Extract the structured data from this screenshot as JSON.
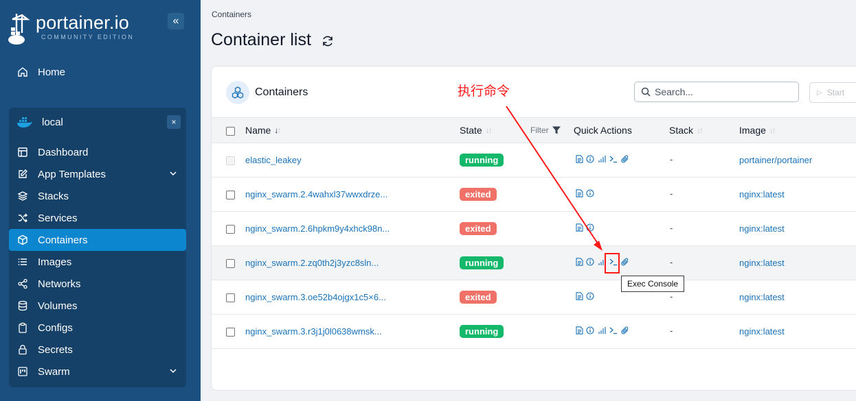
{
  "app": {
    "logo_text": "portainer.io",
    "logo_subtitle": "COMMUNITY EDITION",
    "collapse_icon": "double-chevron-left-icon"
  },
  "sidebar": {
    "home_label": "Home",
    "environment": {
      "name": "local",
      "close_label": "×"
    },
    "items": [
      {
        "label": "Dashboard",
        "icon": "dashboard-icon"
      },
      {
        "label": "App Templates",
        "icon": "edit-icon",
        "expandable": true
      },
      {
        "label": "Stacks",
        "icon": "layers-icon"
      },
      {
        "label": "Services",
        "icon": "shuffle-icon"
      },
      {
        "label": "Containers",
        "icon": "box-icon",
        "active": true
      },
      {
        "label": "Images",
        "icon": "list-icon"
      },
      {
        "label": "Networks",
        "icon": "share-icon"
      },
      {
        "label": "Volumes",
        "icon": "database-icon"
      },
      {
        "label": "Configs",
        "icon": "clipboard-icon"
      },
      {
        "label": "Secrets",
        "icon": "lock-icon"
      },
      {
        "label": "Swarm",
        "icon": "swarm-icon",
        "expandable": true
      }
    ]
  },
  "main": {
    "breadcrumb": "Containers",
    "title": "Container list"
  },
  "card": {
    "title": "Containers",
    "annotation": "执行命令",
    "search_placeholder": "Search...",
    "start_label": "Start",
    "filter_label": "Filter",
    "columns": {
      "name": "Name",
      "state": "State",
      "quick_actions": "Quick Actions",
      "stack": "Stack",
      "image": "Image"
    },
    "rows": [
      {
        "name": "elastic_leakey",
        "state": "running",
        "actions": [
          "logs",
          "inspect",
          "stats",
          "console",
          "attach"
        ],
        "stack": "-",
        "image": "portainer/portainer",
        "checkbox_disabled": true
      },
      {
        "name": "nginx_swarm.2.4wahxl37wwxdrze...",
        "state": "exited",
        "actions": [
          "logs",
          "inspect"
        ],
        "stack": "-",
        "image": "nginx:latest"
      },
      {
        "name": "nginx_swarm.2.6hpkm9y4xhck98n...",
        "state": "exited",
        "actions": [
          "logs",
          "inspect"
        ],
        "stack": "-",
        "image": "nginx:latest"
      },
      {
        "name": "nginx_swarm.2.zq0th2j3yzc8sln...",
        "state": "running",
        "actions": [
          "logs",
          "inspect",
          "stats",
          "console",
          "attach"
        ],
        "stack": "-",
        "image": "nginx:latest",
        "highlighted": true
      },
      {
        "name": "nginx_swarm.3.oe52b4ojgx1c5×6...",
        "state": "exited",
        "actions": [
          "logs",
          "inspect"
        ],
        "stack": "-",
        "image": "nginx:latest"
      },
      {
        "name": "nginx_swarm.3.r3j1j0l0638wmsk...",
        "state": "running",
        "actions": [
          "logs",
          "inspect",
          "stats",
          "console",
          "attach"
        ],
        "stack": "-",
        "image": "nginx:latest"
      }
    ],
    "tooltip": "Exec Console"
  },
  "colors": {
    "sidebar_bg": "#1b4f80",
    "env_bg": "#154067",
    "active_item": "#0d86d0",
    "link": "#1a73b9",
    "running": "#13b86a",
    "exited": "#f07167",
    "annotation_red": "#ff1a1a"
  }
}
